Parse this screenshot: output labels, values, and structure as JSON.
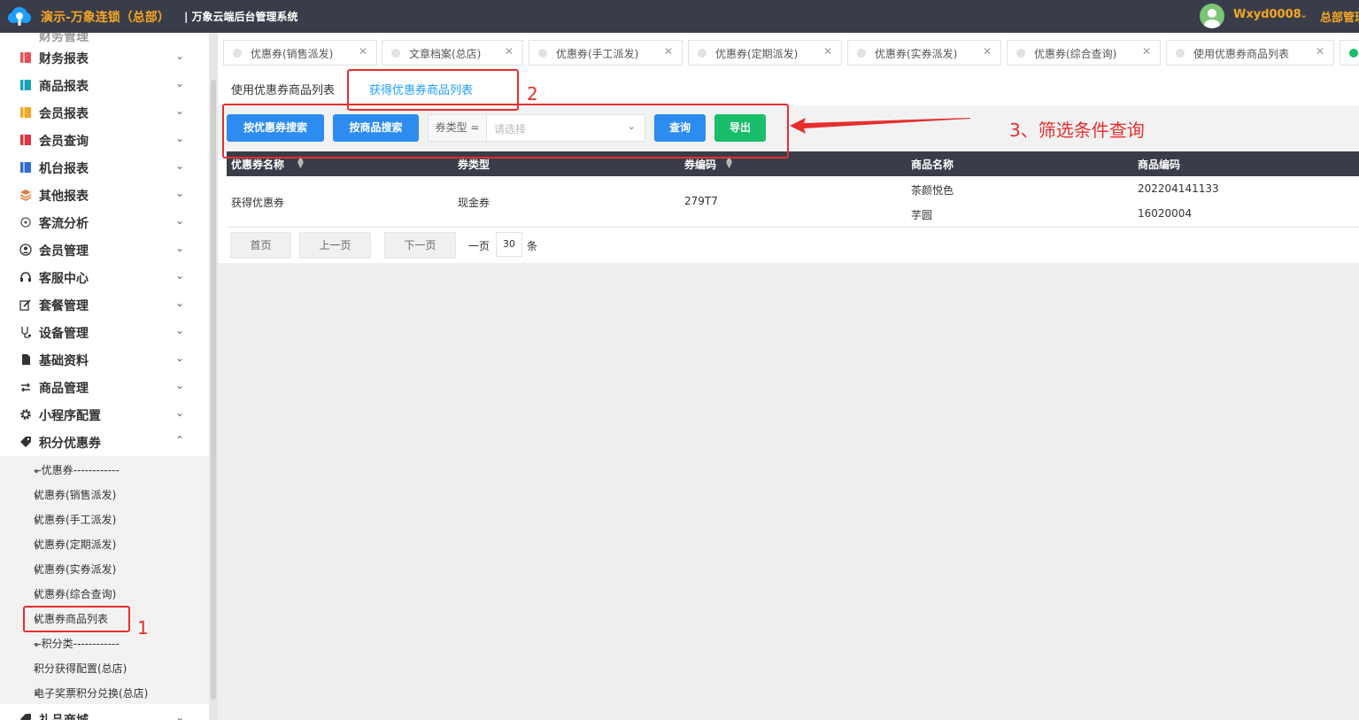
{
  "header": {
    "brand": "演示-万象连锁（总部）",
    "system_name": "| 万象云端后台管理系统",
    "username": "Wxyd0008",
    "right_text": "总部管理"
  },
  "sidebar": {
    "partial_top": "财务管理",
    "items": [
      {
        "label": "财务报表",
        "icon": "finance-report-icon"
      },
      {
        "label": "商品报表",
        "icon": "goods-report-icon"
      },
      {
        "label": "会员报表",
        "icon": "member-report-icon"
      },
      {
        "label": "会员查询",
        "icon": "member-query-icon"
      },
      {
        "label": "机台报表",
        "icon": "machine-report-icon"
      },
      {
        "label": "其他报表",
        "icon": "layers-icon"
      },
      {
        "label": "客流分析",
        "icon": "target-icon"
      },
      {
        "label": "会员管理",
        "icon": "user-icon"
      },
      {
        "label": "客服中心",
        "icon": "headset-icon"
      },
      {
        "label": "套餐管理",
        "icon": "edit-icon"
      },
      {
        "label": "设备管理",
        "icon": "stethoscope-icon"
      },
      {
        "label": "基础资料",
        "icon": "file-icon"
      },
      {
        "label": "商品管理",
        "icon": "swap-icon"
      },
      {
        "label": "小程序配置",
        "icon": "gear-icon"
      },
      {
        "label": "积分优惠券",
        "icon": "tag-icon"
      }
    ],
    "subitems": [
      "--优惠券------------",
      "优惠券(销售派发)",
      "优惠券(手工派发)",
      "优惠券(定期派发)",
      "优惠券(实券派发)",
      "优惠券(综合查询)",
      "优惠券商品列表",
      "--积分类------------",
      "积分获得配置(总店)",
      "电子奖票积分兑换(总店)"
    ],
    "partial_bottom": "礼品商城"
  },
  "tabs": [
    "优惠券(销售派发)",
    "文章档案(总店)",
    "优惠券(手工派发)",
    "优惠券(定期派发)",
    "优惠券(实券派发)",
    "优惠券(综合查询)",
    "使用优惠券商品列表"
  ],
  "subtabs": [
    "使用优惠券商品列表",
    "获得优惠券商品列表"
  ],
  "toolbar": {
    "search_by_coupon": "按优惠券搜索",
    "search_by_goods": "按商品搜索",
    "coupon_type_label": "券类型 =",
    "coupon_type_placeholder": "请选择",
    "query": "查询",
    "export": "导出"
  },
  "table": {
    "columns": [
      "优惠券名称",
      "券类型",
      "券编码",
      "商品名称",
      "商品编码"
    ],
    "rows": [
      {
        "coupon_name": "获得优惠券",
        "coupon_type": "现金券",
        "coupon_code": "279T7",
        "goods": [
          {
            "name": "茶颜悦色",
            "code": "202204141133"
          },
          {
            "name": "芋圆",
            "code": "16020004"
          }
        ]
      }
    ]
  },
  "pager": {
    "first": "首页",
    "prev": "上一页",
    "next": "下一页",
    "per_page_prefix": "一页",
    "per_page_value": "30",
    "per_page_suffix": "条"
  },
  "annotations": {
    "n1": "1",
    "n2": "2",
    "n3": "3、筛选条件查询"
  },
  "colors": {
    "topbar": "#393d49",
    "brand": "#f5a623",
    "primary": "#2d8cf0",
    "success": "#19be6b",
    "annotation": "#e62e2e",
    "active_tab": "#1e9fff"
  }
}
